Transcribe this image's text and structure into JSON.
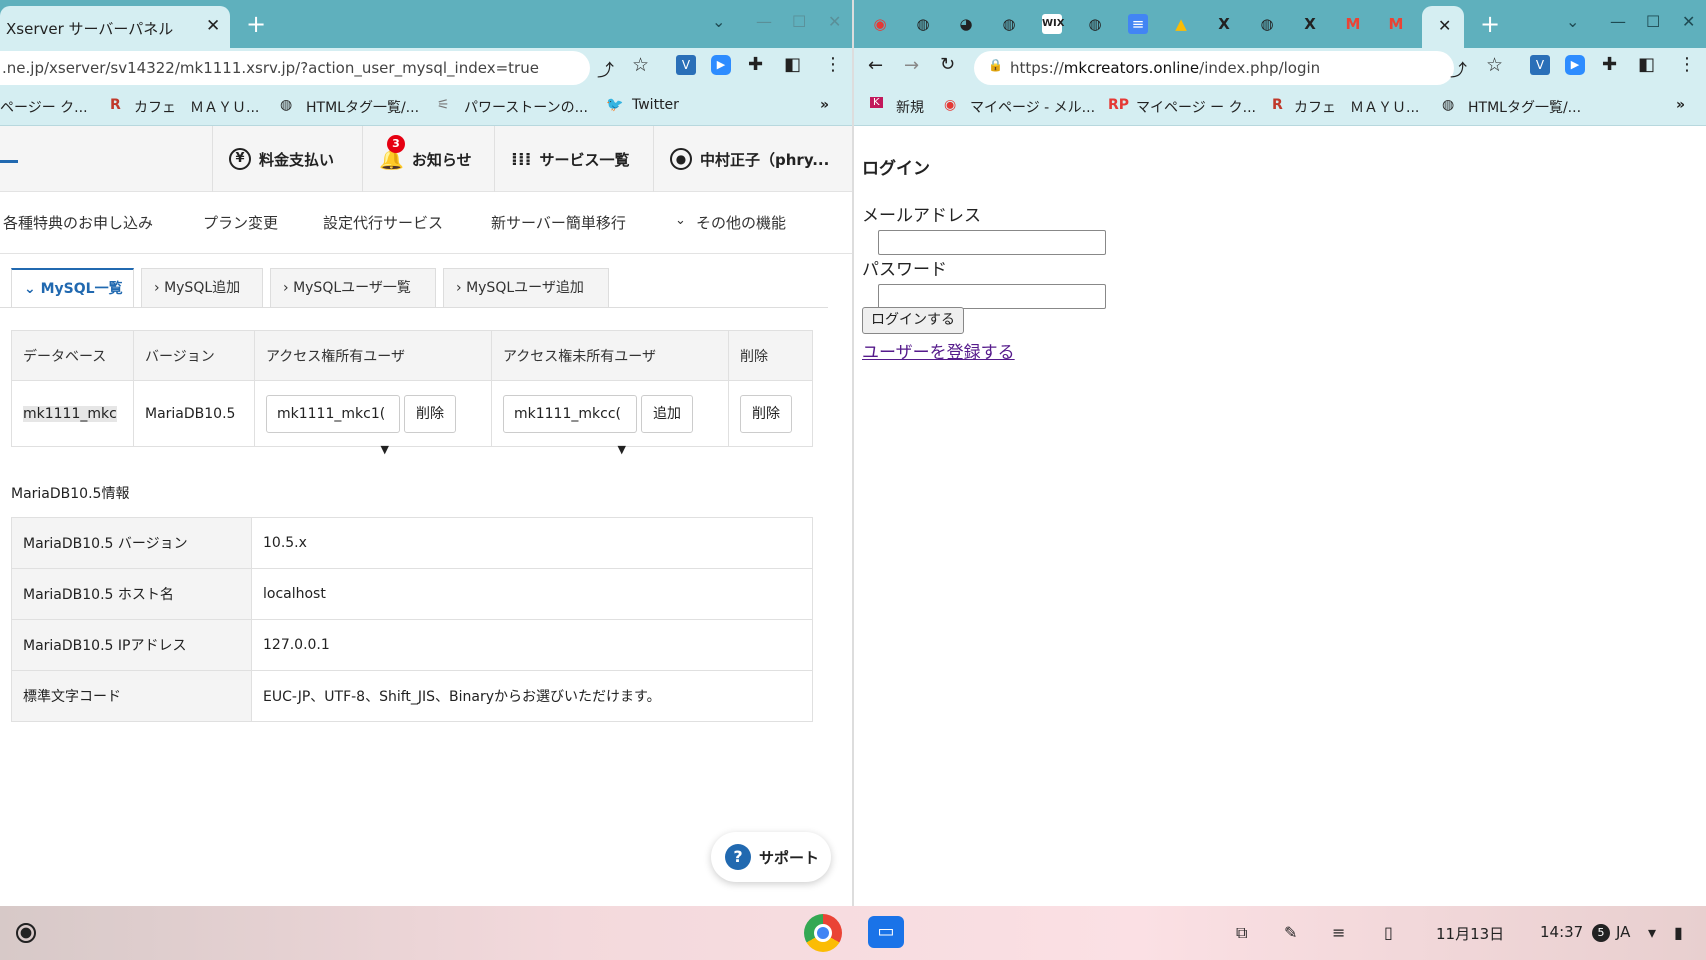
{
  "left": {
    "tab_title": "Xserver サーバーパネル",
    "url": ".ne.jp/xserver/sv14322/mk1111.xsrv.jp/?action_user_mysql_index=true",
    "bookmarks": [
      "ページー ク...",
      "カフェ　ＭＡＹＵ...",
      "HTMLタグ一覧/...",
      "パワーストーンの...",
      "Twitter"
    ],
    "header": {
      "payment": "料金支払い",
      "notice": "お知らせ",
      "notice_badge": "3",
      "services": "サービス一覧",
      "user": "中村正子（phry..."
    },
    "subnav": [
      "各種特典のお申し込み",
      "プラン変更",
      "設定代行サービス",
      "新サーバー簡単移行",
      "その他の機能"
    ],
    "tabs": [
      "MySQL一覧",
      "MySQL追加",
      "MySQLユーザ一覧",
      "MySQLユーザ追加"
    ],
    "db_table": {
      "headers": [
        "データベース",
        "バージョン",
        "アクセス権所有ユーザ",
        "アクセス権未所有ユーザ",
        "削除"
      ],
      "row": {
        "db": "mk1111_mkc",
        "version": "MariaDB10.5",
        "owner_select": "mk1111_mkc1(",
        "owner_btn": "削除",
        "nonowner_select": "mk1111_mkcc(",
        "nonowner_btn": "追加",
        "delete_btn": "削除"
      }
    },
    "info_title": "MariaDB10.5情報",
    "info_rows": [
      {
        "k": "MariaDB10.5 バージョン",
        "v": "10.5.x"
      },
      {
        "k": "MariaDB10.5 ホスト名",
        "v": "localhost"
      },
      {
        "k": "MariaDB10.5 IPアドレス",
        "v": "127.0.0.1"
      },
      {
        "k": "標準文字コード",
        "v": "EUC-JP、UTF-8、Shift_JIS、Binaryからお選びいただけます。"
      }
    ],
    "support": "サポート"
  },
  "right": {
    "url_prefix": "https://",
    "url_host": "mkcreators.online",
    "url_path": "/index.php/login",
    "bookmarks": [
      "新規",
      "マイページ - メル...",
      "マイページ ー ク...",
      "カフェ　ＭＡＹＵ...",
      "HTMLタグ一覧/..."
    ],
    "heading": "ログイン",
    "email_label": "メールアドレス",
    "password_label": "パスワード",
    "login_btn": "ログインする",
    "register_link": "ユーザーを登録する"
  },
  "taskbar": {
    "date": "11月13日",
    "time": "14:37",
    "lang": "JA",
    "notif": "5"
  },
  "colors": {
    "tabstrip": "#5fb0bd",
    "toolbar": "#d5eef2",
    "accent": "#2169b0",
    "link": "#551a8b"
  }
}
